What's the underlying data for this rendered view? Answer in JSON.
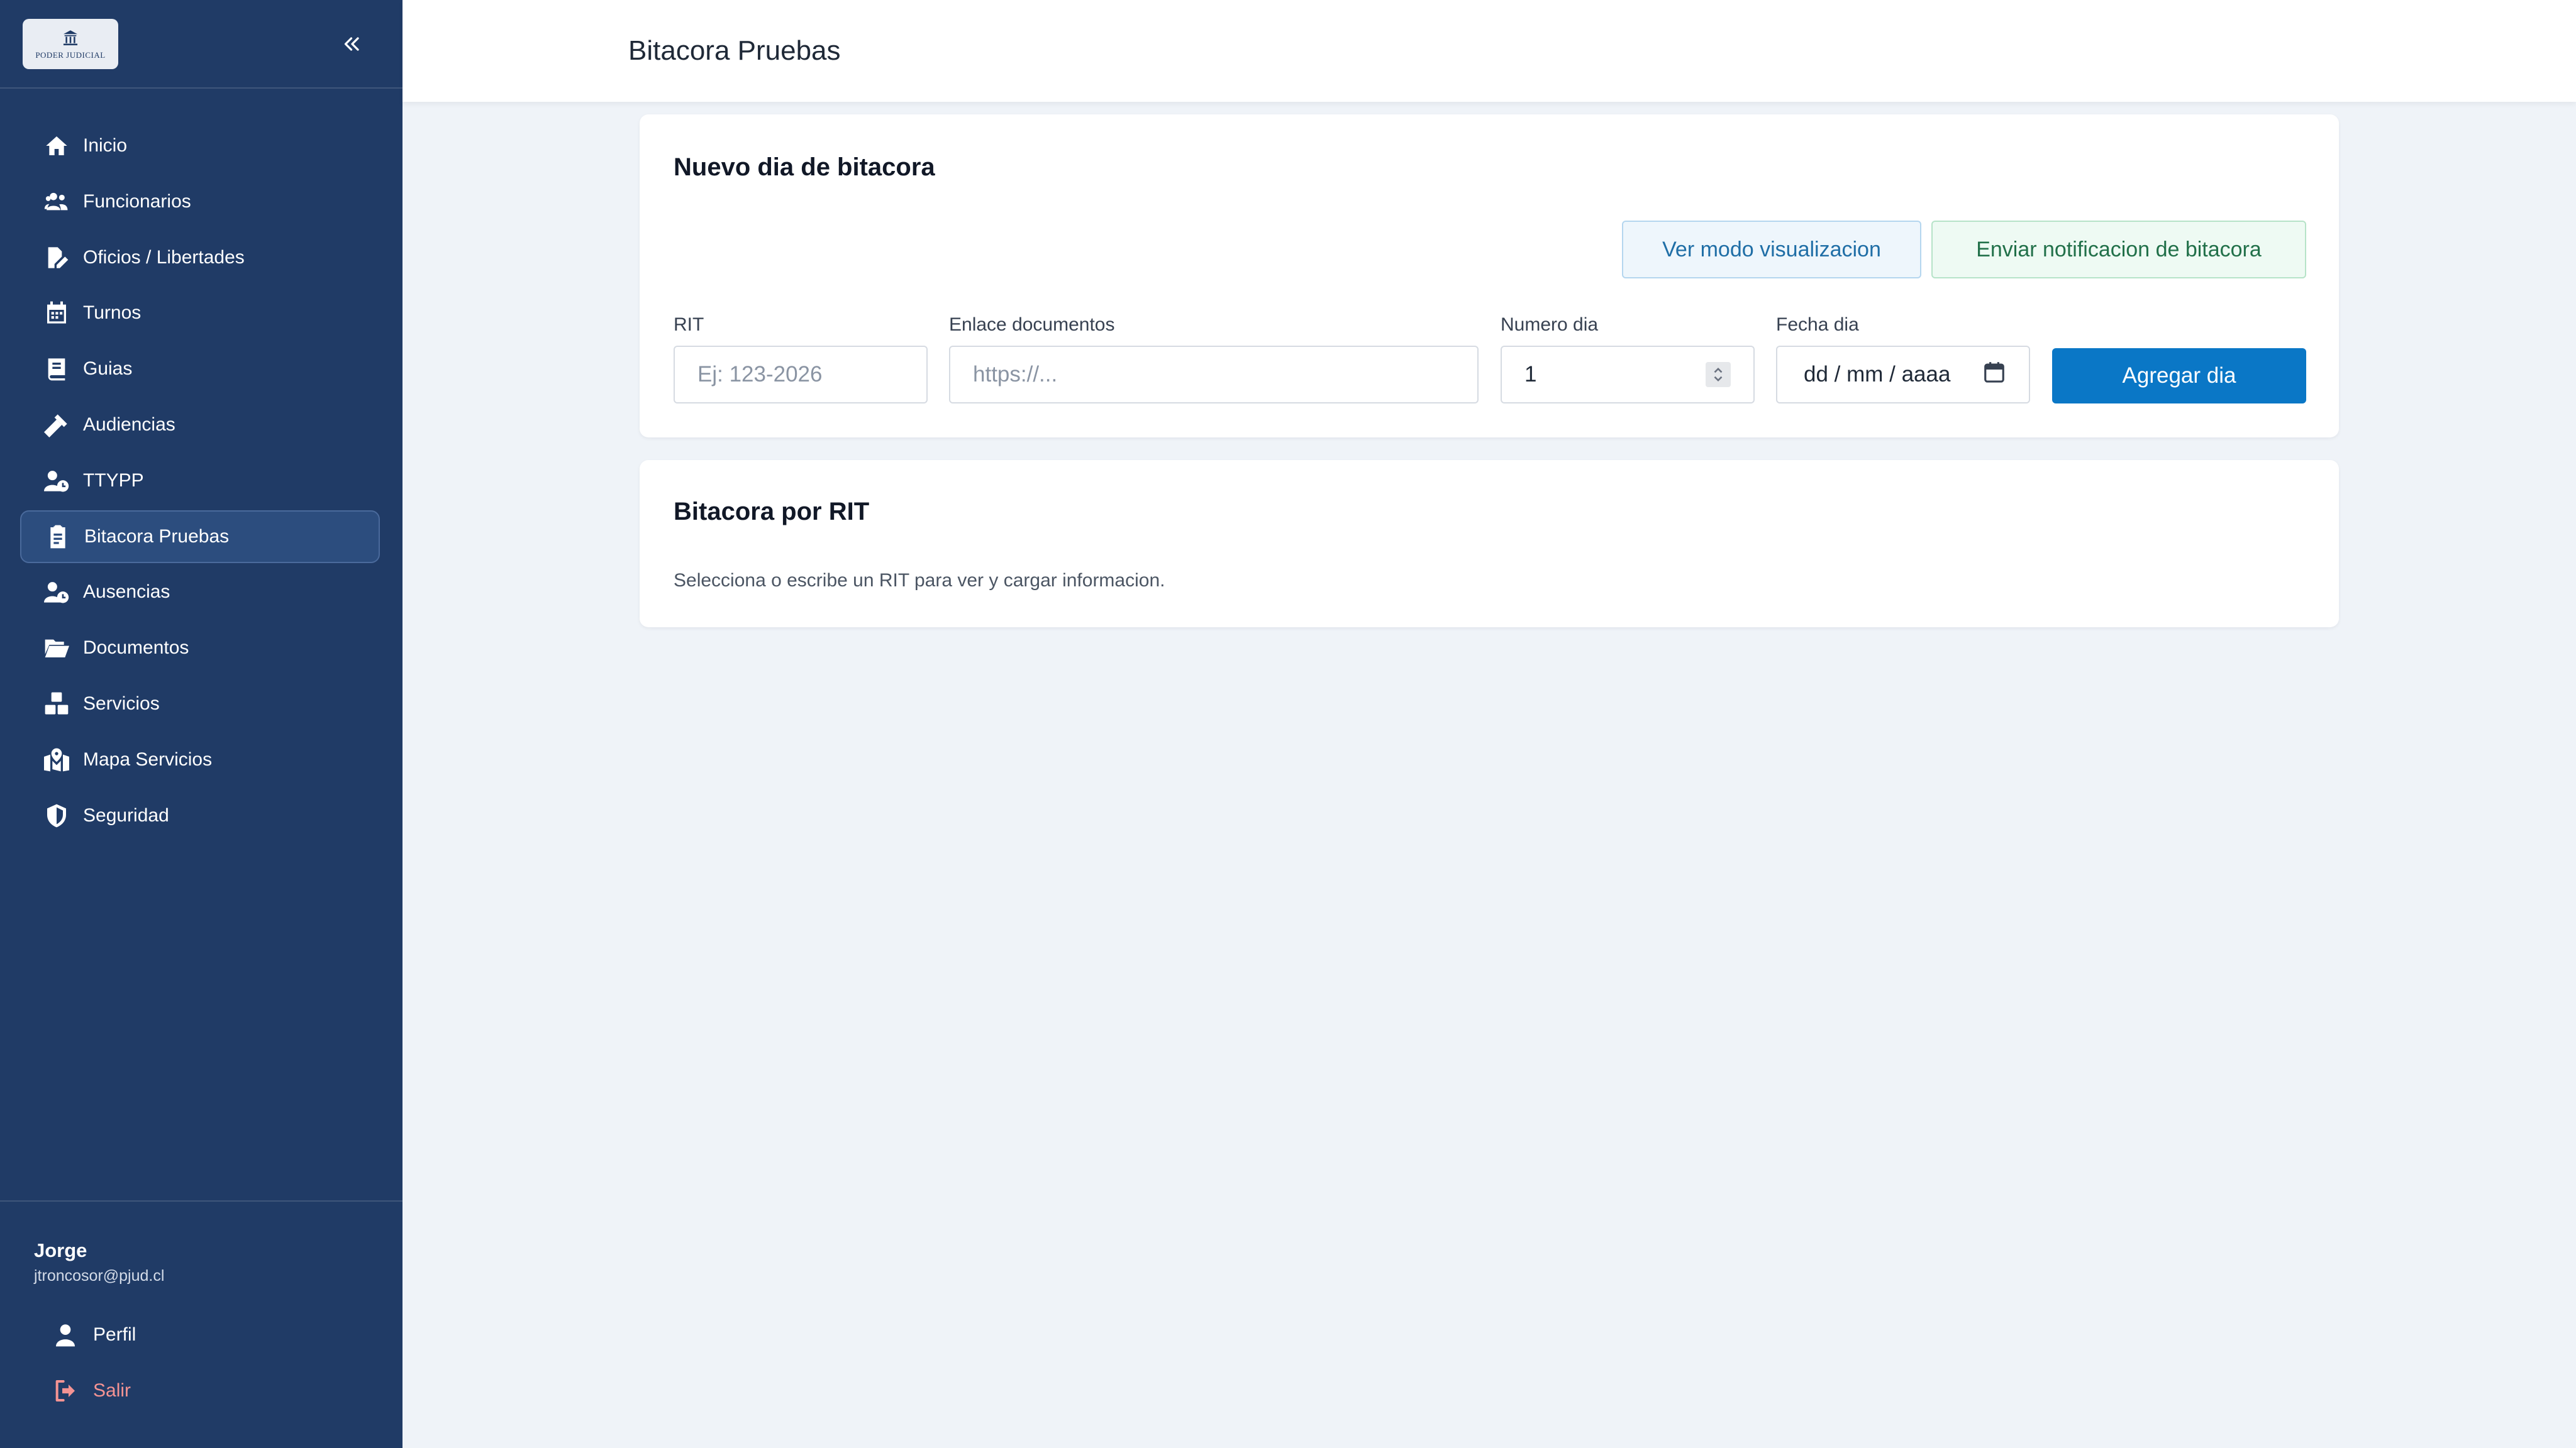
{
  "brand": {
    "logo_text": "PODER JUDICIAL"
  },
  "sidebar": {
    "items": [
      {
        "label": "Inicio",
        "icon": "home-icon",
        "active": false
      },
      {
        "label": "Funcionarios",
        "icon": "users-icon",
        "active": false
      },
      {
        "label": "Oficios / Libertades",
        "icon": "file-signature-icon",
        "active": false
      },
      {
        "label": "Turnos",
        "icon": "calendar-icon",
        "active": false
      },
      {
        "label": "Guias",
        "icon": "book-icon",
        "active": false
      },
      {
        "label": "Audiencias",
        "icon": "gavel-icon",
        "active": false
      },
      {
        "label": "TTYPP",
        "icon": "user-clock-icon",
        "active": false
      },
      {
        "label": "Bitacora Pruebas",
        "icon": "clipboard-icon",
        "active": true
      },
      {
        "label": "Ausencias",
        "icon": "user-clock-icon",
        "active": false
      },
      {
        "label": "Documentos",
        "icon": "folder-open-icon",
        "active": false
      },
      {
        "label": "Servicios",
        "icon": "boxes-icon",
        "active": false
      },
      {
        "label": "Mapa Servicios",
        "icon": "map-marked-icon",
        "active": false
      },
      {
        "label": "Seguridad",
        "icon": "shield-icon",
        "active": false
      }
    ],
    "user": {
      "name": "Jorge",
      "email": "jtroncosor@pjud.cl"
    },
    "footer": {
      "profile_label": "Perfil",
      "logout_label": "Salir"
    }
  },
  "header": {
    "title": "Bitacora Pruebas"
  },
  "new_day_card": {
    "title": "Nuevo dia de bitacora",
    "view_mode_label": "Ver modo visualizacion",
    "notify_label": "Enviar notificacion de bitacora",
    "fields": {
      "rit": {
        "label": "RIT",
        "placeholder": "Ej: 123-2026",
        "value": ""
      },
      "link": {
        "label": "Enlace documentos",
        "placeholder": "https://...",
        "value": ""
      },
      "day_number": {
        "label": "Numero dia",
        "value": "1"
      },
      "day_date": {
        "label": "Fecha dia",
        "value": "dd / mm / aaaa"
      }
    },
    "add_label": "Agregar dia"
  },
  "rit_card": {
    "title": "Bitacora por RIT",
    "hint": "Selecciona o escribe un RIT para ver y cargar informacion."
  },
  "colors": {
    "sidebar_bg": "#203b66",
    "sidebar_active": "#2c4d7e",
    "primary": "#0a77c6",
    "logout": "#f49393",
    "page_bg": "#eff3f8"
  }
}
